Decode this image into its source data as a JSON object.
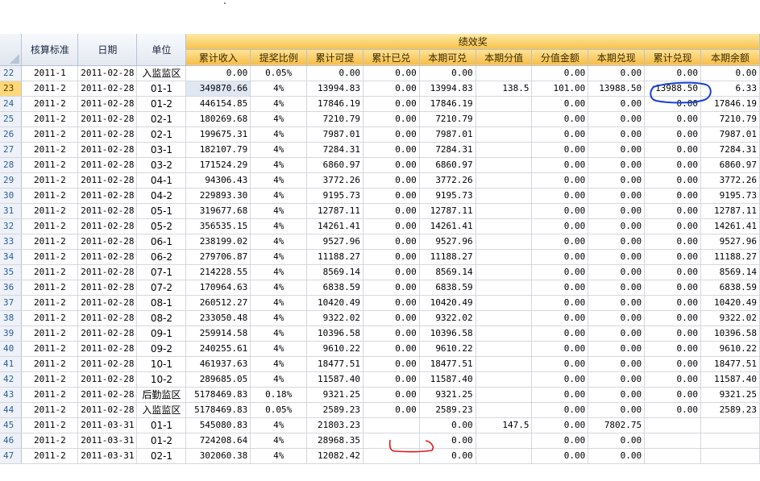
{
  "header": {
    "row_header": "",
    "col_standard": "核算标准",
    "col_date": "日期",
    "col_unit": "单位",
    "group_label": "绩效奖",
    "sub_columns": [
      "累计收入",
      "提奖比例",
      "累计可提",
      "累计已兑",
      "本期可兑",
      "本期分值",
      "分值金额",
      "本期兑现",
      "累计兑现",
      "本期余额"
    ]
  },
  "rows": [
    [
      "22",
      "2011-1",
      "2011-02-28",
      "入监监区",
      "0.00",
      "0.05%",
      "0.00",
      "0.00",
      "0.00",
      "",
      "0.00",
      "0.00",
      "0.00",
      "0.00"
    ],
    [
      "23",
      "2011-2",
      "2011-02-28",
      "01-1",
      "349870.66",
      "4%",
      "13994.83",
      "0.00",
      "13994.83",
      "138.5",
      "101.00",
      "13988.50",
      "13988.50",
      "6.33"
    ],
    [
      "24",
      "2011-2",
      "2011-02-28",
      "01-2",
      "446154.85",
      "4%",
      "17846.19",
      "0.00",
      "17846.19",
      "",
      "0.00",
      "0.00",
      "0.00",
      "17846.19"
    ],
    [
      "25",
      "2011-2",
      "2011-02-28",
      "02-1",
      "180269.68",
      "4%",
      "7210.79",
      "0.00",
      "7210.79",
      "",
      "0.00",
      "0.00",
      "0.00",
      "7210.79"
    ],
    [
      "26",
      "2011-2",
      "2011-02-28",
      "02-1",
      "199675.31",
      "4%",
      "7987.01",
      "0.00",
      "7987.01",
      "",
      "0.00",
      "0.00",
      "0.00",
      "7987.01"
    ],
    [
      "27",
      "2011-2",
      "2011-02-28",
      "03-1",
      "182107.79",
      "4%",
      "7284.31",
      "0.00",
      "7284.31",
      "",
      "0.00",
      "0.00",
      "0.00",
      "7284.31"
    ],
    [
      "28",
      "2011-2",
      "2011-02-28",
      "03-2",
      "171524.29",
      "4%",
      "6860.97",
      "0.00",
      "6860.97",
      "",
      "0.00",
      "0.00",
      "0.00",
      "6860.97"
    ],
    [
      "29",
      "2011-2",
      "2011-02-28",
      "04-1",
      "94306.43",
      "4%",
      "3772.26",
      "0.00",
      "3772.26",
      "",
      "0.00",
      "0.00",
      "0.00",
      "3772.26"
    ],
    [
      "30",
      "2011-2",
      "2011-02-28",
      "04-2",
      "229893.30",
      "4%",
      "9195.73",
      "0.00",
      "9195.73",
      "",
      "0.00",
      "0.00",
      "0.00",
      "9195.73"
    ],
    [
      "31",
      "2011-2",
      "2011-02-28",
      "05-1",
      "319677.68",
      "4%",
      "12787.11",
      "0.00",
      "12787.11",
      "",
      "0.00",
      "0.00",
      "0.00",
      "12787.11"
    ],
    [
      "32",
      "2011-2",
      "2011-02-28",
      "05-2",
      "356535.15",
      "4%",
      "14261.41",
      "0.00",
      "14261.41",
      "",
      "0.00",
      "0.00",
      "0.00",
      "14261.41"
    ],
    [
      "33",
      "2011-2",
      "2011-02-28",
      "06-1",
      "238199.02",
      "4%",
      "9527.96",
      "0.00",
      "9527.96",
      "",
      "0.00",
      "0.00",
      "0.00",
      "9527.96"
    ],
    [
      "34",
      "2011-2",
      "2011-02-28",
      "06-2",
      "279706.87",
      "4%",
      "11188.27",
      "0.00",
      "11188.27",
      "",
      "0.00",
      "0.00",
      "0.00",
      "11188.27"
    ],
    [
      "35",
      "2011-2",
      "2011-02-28",
      "07-1",
      "214228.55",
      "4%",
      "8569.14",
      "0.00",
      "8569.14",
      "",
      "0.00",
      "0.00",
      "0.00",
      "8569.14"
    ],
    [
      "36",
      "2011-2",
      "2011-02-28",
      "07-2",
      "170964.63",
      "4%",
      "6838.59",
      "0.00",
      "6838.59",
      "",
      "0.00",
      "0.00",
      "0.00",
      "6838.59"
    ],
    [
      "37",
      "2011-2",
      "2011-02-28",
      "08-1",
      "260512.27",
      "4%",
      "10420.49",
      "0.00",
      "10420.49",
      "",
      "0.00",
      "0.00",
      "0.00",
      "10420.49"
    ],
    [
      "38",
      "2011-2",
      "2011-02-28",
      "08-2",
      "233050.48",
      "4%",
      "9322.02",
      "0.00",
      "9322.02",
      "",
      "0.00",
      "0.00",
      "0.00",
      "9322.02"
    ],
    [
      "39",
      "2011-2",
      "2011-02-28",
      "09-1",
      "259914.58",
      "4%",
      "10396.58",
      "0.00",
      "10396.58",
      "",
      "0.00",
      "0.00",
      "0.00",
      "10396.58"
    ],
    [
      "40",
      "2011-2",
      "2011-02-28",
      "09-2",
      "240255.61",
      "4%",
      "9610.22",
      "0.00",
      "9610.22",
      "",
      "0.00",
      "0.00",
      "0.00",
      "9610.22"
    ],
    [
      "41",
      "2011-2",
      "2011-02-28",
      "10-1",
      "461937.63",
      "4%",
      "18477.51",
      "0.00",
      "18477.51",
      "",
      "0.00",
      "0.00",
      "0.00",
      "18477.51"
    ],
    [
      "42",
      "2011-2",
      "2011-02-28",
      "10-2",
      "289685.05",
      "4%",
      "11587.40",
      "0.00",
      "11587.40",
      "",
      "0.00",
      "0.00",
      "0.00",
      "11587.40"
    ],
    [
      "43",
      "2011-2",
      "2011-02-28",
      "后勤监区",
      "5178469.83",
      "0.18%",
      "9321.25",
      "0.00",
      "9321.25",
      "",
      "0.00",
      "0.00",
      "0.00",
      "9321.25"
    ],
    [
      "44",
      "2011-2",
      "2011-02-28",
      "入监监区",
      "5178469.83",
      "0.05%",
      "2589.23",
      "0.00",
      "2589.23",
      "",
      "0.00",
      "0.00",
      "0.00",
      "2589.23"
    ],
    [
      "45",
      "2011-2",
      "2011-03-31",
      "01-1",
      "545080.83",
      "4%",
      "21803.23",
      "",
      "0.00",
      "147.5",
      "0.00",
      "7802.75",
      "",
      ""
    ],
    [
      "46",
      "2011-2",
      "2011-03-31",
      "01-2",
      "724208.64",
      "4%",
      "28968.35",
      "",
      "0.00",
      "",
      "0.00",
      "0.00",
      "",
      ""
    ],
    [
      "47",
      "2011-2",
      "2011-03-31",
      "02-1",
      "302060.38",
      "4%",
      "12082.42",
      "",
      "0.00",
      "",
      "0.00",
      "0.00",
      "",
      ""
    ]
  ],
  "selected_row": "23",
  "annotation_colors": {
    "blue_circle": "#1a3fd6",
    "red_mark": "#e01818"
  }
}
